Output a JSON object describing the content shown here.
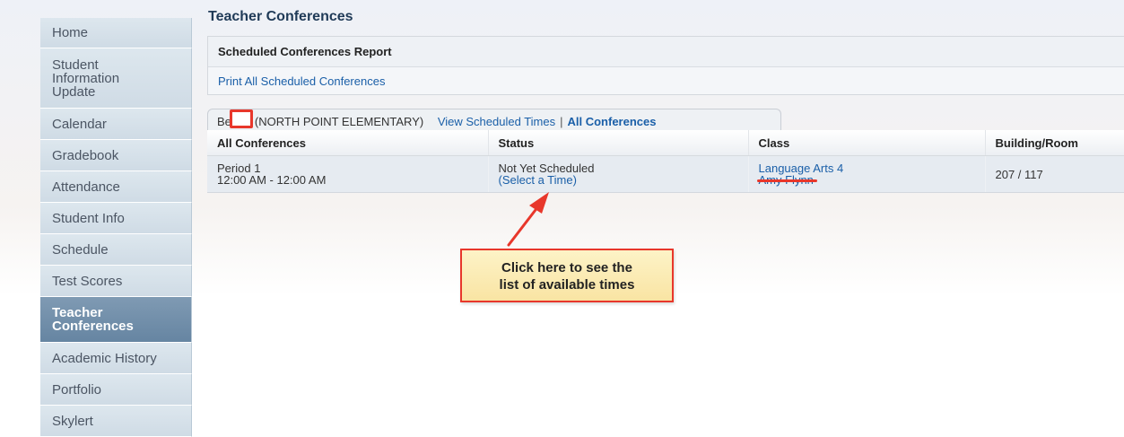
{
  "sidebar": {
    "items": [
      {
        "label": "Home"
      },
      {
        "label": "Student Information Update"
      },
      {
        "label": "Calendar"
      },
      {
        "label": "Gradebook"
      },
      {
        "label": "Attendance"
      },
      {
        "label": "Student Info"
      },
      {
        "label": "Schedule"
      },
      {
        "label": "Test Scores"
      },
      {
        "label": "Teacher Conferences"
      },
      {
        "label": "Academic History"
      },
      {
        "label": "Portfolio"
      },
      {
        "label": "Skylert"
      }
    ],
    "active_index": 8
  },
  "page": {
    "title": "Teacher Conferences"
  },
  "report": {
    "header": "Scheduled Conferences Report",
    "link": "Print All Scheduled Conferences"
  },
  "tab": {
    "student_prefix": "Be",
    "school": "(NORTH POINT ELEMENTARY)",
    "view_scheduled": "View Scheduled Times",
    "separator": "|",
    "all_conferences": "All Conferences"
  },
  "table": {
    "columns": [
      "All Conferences",
      "Status",
      "Class",
      "Building/Room"
    ],
    "rows": [
      {
        "period": "Period 1",
        "time": "12:00 AM - 12:00 AM",
        "status": "Not Yet Scheduled",
        "select_link": "(Select a Time)",
        "class_name": "Language Arts 4",
        "teacher": "Amy Flynn",
        "room": "207 / 117"
      }
    ]
  },
  "callout": {
    "line1": "Click here to see the",
    "line2": "list of available times"
  },
  "colors": {
    "accent_red": "#e8372b",
    "link_blue": "#1a5fa8",
    "active_nav": "#6f8eaa",
    "callout_fill": "#fbeab4"
  }
}
